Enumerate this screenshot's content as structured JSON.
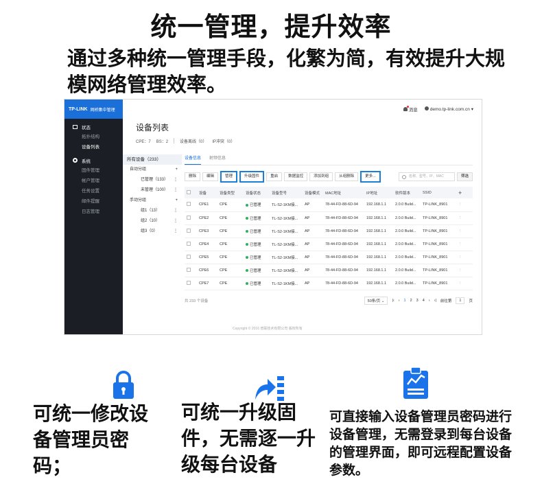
{
  "headline": "统一管理，提升效率",
  "subhead": "通过多种统一管理手段，化繁为简，有效提升大规模网络管理效率。",
  "app": {
    "brand": "TP-LINK",
    "brand_sub": "网桥集中管理",
    "nav": {
      "status": "状态",
      "status_items": [
        "拓扑结构",
        "设备列表"
      ],
      "system": "系统",
      "system_items": [
        "固件管理",
        "帐户管理",
        "任务设置",
        "邮件提醒",
        "日志管理"
      ]
    },
    "topbar": {
      "messages": "消息",
      "user": "demo.tp-link.com.cn"
    },
    "page_title": "设备列表",
    "stats": {
      "cpe": "CPE：7",
      "bs": "BS：2",
      "offline": "设备离线（0）",
      "ip_conflict": "IP冲突（0）"
    },
    "groups": {
      "all": "所有设备（233）",
      "auto": "自动分组",
      "managed": "已管理（133）",
      "unmanaged": "未管理（100）",
      "manual": "手动分组",
      "g1": "组1（13）",
      "g2": "组2（10）",
      "g3": "组3（0）"
    },
    "tabs": [
      "设备信息",
      "射频信息"
    ],
    "toolbar": [
      "删除",
      "编辑",
      "管理",
      "升级固件",
      "重启",
      "数据监控",
      "添加到组",
      "从组删除",
      "更多..."
    ],
    "search_placeholder": "名称、型号、IP、MAC",
    "filter": "筛选",
    "columns": [
      "设备",
      "设备类型",
      "设备状态",
      "设备型号",
      "设备模式",
      "MAC地址",
      "IP地址",
      "软件版本",
      "SSID"
    ],
    "rows": [
      [
        "CPE1",
        "CPE",
        "已管理",
        "TL-S2-1KM接...",
        "AP",
        "78-44-FD-88-6D-94",
        "192.168.1.1",
        "2.0.0 Build...",
        "TP-LINK_8901"
      ],
      [
        "CPE2",
        "CPE",
        "已管理",
        "TL-S2-1KM接...",
        "AP",
        "78-44-FD-88-6D-94",
        "192.168.1.1",
        "2.0.0 Build...",
        "TP-LINK_8901"
      ],
      [
        "CPE3",
        "CPE",
        "已管理",
        "TL-S2-1KM接...",
        "AP",
        "78-44-FD-88-6D-94",
        "192.168.1.1",
        "2.0.0 Build...",
        "TP-LINK_8901"
      ],
      [
        "CPE4",
        "CPE",
        "已管理",
        "TL-S2-1KM接...",
        "AP",
        "78-44-FD-88-6D-94",
        "192.168.1.1",
        "2.0.0 Build...",
        "TP-LINK_8901"
      ],
      [
        "CPE5",
        "CPE",
        "已管理",
        "TL-S2-1KM接...",
        "AP",
        "78-44-FD-88-6D-94",
        "192.168.1.1",
        "2.0.0 Build...",
        "TP-LINK_8901"
      ],
      [
        "CPE6",
        "CPE",
        "已管理",
        "TL-S2-1KM接...",
        "AP",
        "78-44-FD-88-6D-94",
        "192.168.1.1",
        "2.0.0 Build...",
        "TP-LINK_8901"
      ],
      [
        "CPE7",
        "CPE",
        "已管理",
        "TL-S2-1KM接...",
        "AP",
        "78-44-FD-88-6D-94",
        "192.168.1.1",
        "2.0.0 Build...",
        "TP-LINK_8901"
      ]
    ],
    "footer": {
      "total": "共 233 个设备",
      "per_page": "50条/页",
      "pages": [
        "1",
        "2",
        "3",
        "4"
      ],
      "goto": "前往第",
      "goto_page": "1",
      "goto_suffix": "页"
    },
    "copyright": "Copyright © 2016 普联技术有限公司 版权所有"
  },
  "features": [
    {
      "icon": "lock-icon",
      "text": "可统一修改设备管理员密码；"
    },
    {
      "icon": "upgrade-icon",
      "text": "可统一升级固件，无需逐一升级每台设备"
    },
    {
      "icon": "clipboard-chart-icon",
      "text": "可直接输入设备管理员密码进行设备管理，无需登录到每台设备的管理界面，即可远程配置设备参数。"
    }
  ],
  "colors": {
    "accent": "#1a6fd8",
    "sidebar": "#1b1e24",
    "status_ok": "#2fb15f",
    "icon_blue": "#1a73e8"
  }
}
